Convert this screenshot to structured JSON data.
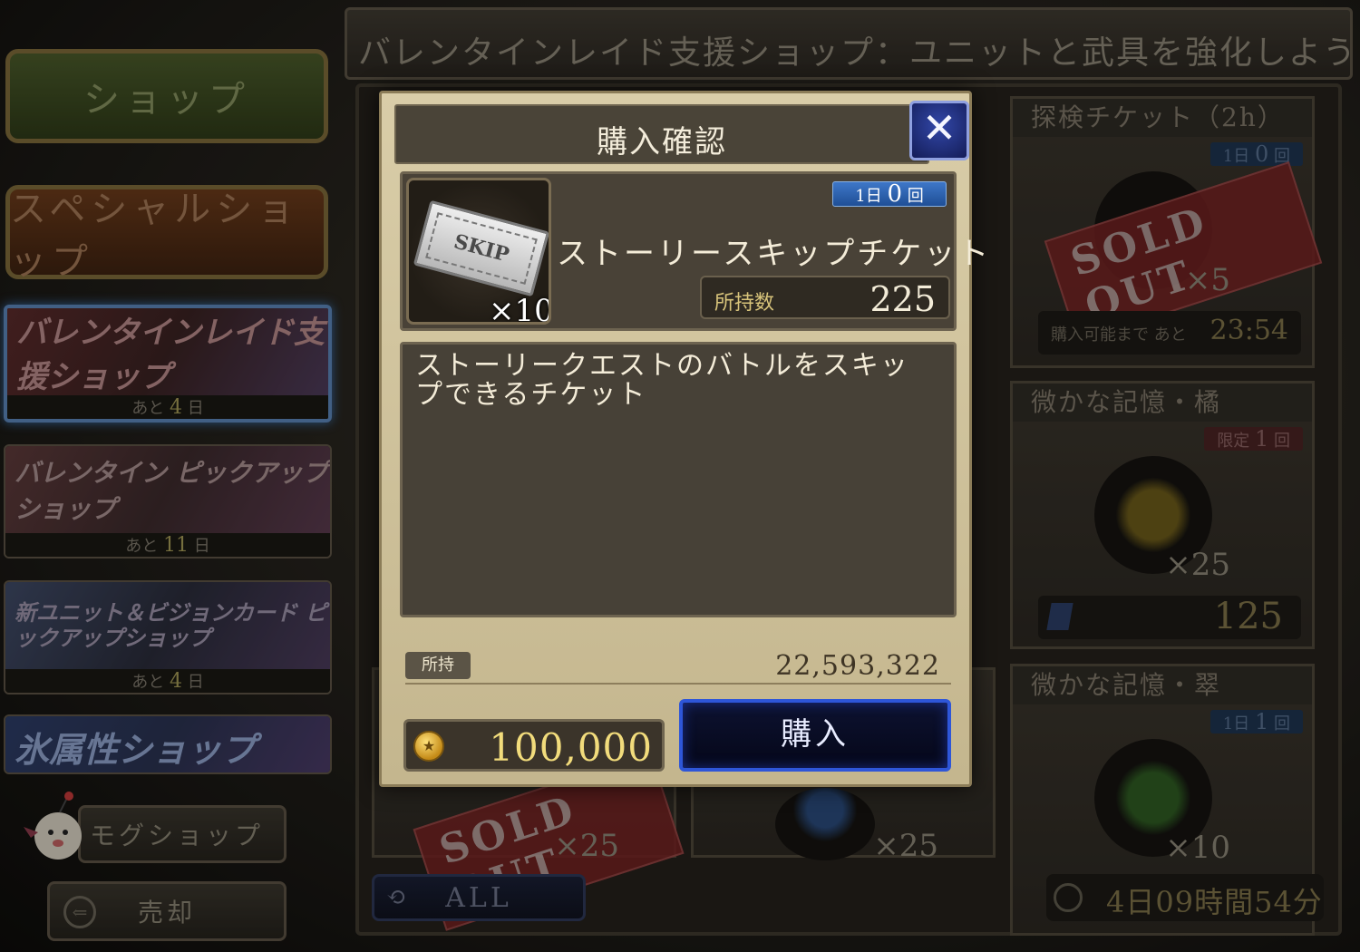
{
  "header": {
    "title": "バレンタインレイド支援ショップ：ユニットと武具を強化しよう！"
  },
  "sidebar": {
    "shop_label": "ショップ",
    "special_label": "スペシャルショップ",
    "banners": [
      {
        "title": "バレンタインレイド支援ショップ",
        "remain_prefix": "あと",
        "remain_num": "4",
        "remain_suffix": "日"
      },
      {
        "title": "バレンタイン ピックアップショップ",
        "remain_prefix": "あと",
        "remain_num": "11",
        "remain_suffix": "日"
      },
      {
        "title": "新ユニット＆ビジョンカード ピックアップショップ",
        "remain_prefix": "あと",
        "remain_num": "4",
        "remain_suffix": "日"
      },
      {
        "title": "氷属性ショップ"
      }
    ],
    "mog_label": "モグショップ",
    "sell_label": "売却"
  },
  "cards": {
    "explore": {
      "title": "探検チケット（2h）",
      "limit_prefix": "1日",
      "limit_num": "0",
      "limit_suffix": "回",
      "sold_out": "SOLD OUT",
      "qty": "×5",
      "timer_label": "購入可能まで あと",
      "timer_value": "23:54"
    },
    "orange": {
      "title": "微かな記憶・橘",
      "limit_prefix": "限定",
      "limit_num": "1",
      "limit_suffix": "回",
      "qty": "×25",
      "price": "125"
    },
    "green": {
      "title": "微かな記憶・翠",
      "limit_prefix": "1日",
      "limit_num": "1",
      "limit_suffix": "回",
      "qty": "×10"
    },
    "bottom_left": {
      "sold_out": "SOLD OUT",
      "qty": "×25"
    },
    "bottom_mid": {
      "qty": "×25"
    }
  },
  "footer": {
    "filter_label": "ALL",
    "time_left": "4日09時間54分"
  },
  "modal": {
    "title": "購入確認",
    "item": {
      "icon_text": "SKIP",
      "multiplier": "×10",
      "limit_prefix": "1日",
      "limit_num": "0",
      "limit_suffix": "回",
      "name": "ストーリースキップチケット",
      "owned_label": "所持数",
      "owned_value": "225"
    },
    "description": "ストーリークエストのバトルをスキップできるチケット",
    "holding_label": "所持",
    "holding_value": "22,593,322",
    "price": "100,000",
    "buy_label": "購入"
  },
  "icons": {
    "close": "close-icon",
    "coin": "gil-coin-icon",
    "ticket": "skip-ticket-icon",
    "clock": "clock-icon",
    "refresh": "refresh-icon",
    "moogle": "moogle-icon",
    "sell": "sell-icon"
  }
}
